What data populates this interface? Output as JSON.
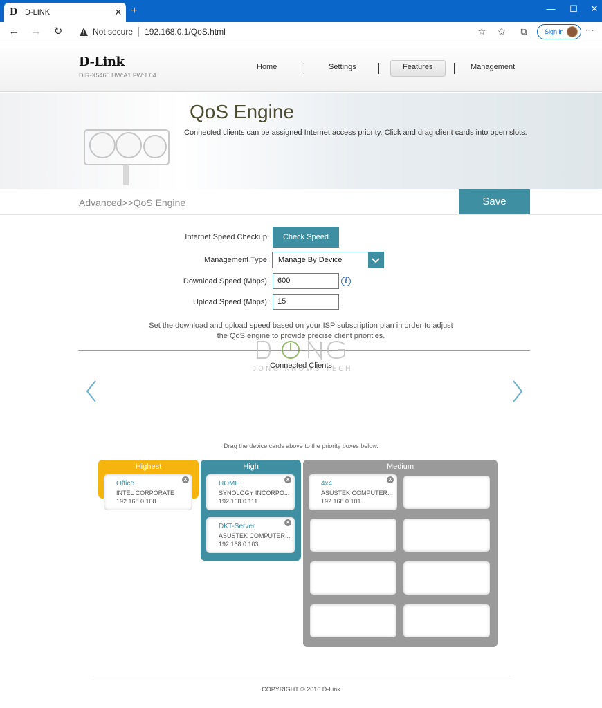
{
  "browser": {
    "tab_title": "D-LINK",
    "tab_favicon": "D",
    "new_tab": "+",
    "not_secure": "Not secure",
    "url": "192.168.0.1/QoS.html",
    "sign_in": "Sign in",
    "icons": [
      "back-arrow-icon",
      "forward-arrow-icon",
      "refresh-icon",
      "warning-triangle-icon",
      "star-add-icon",
      "favorites-icon",
      "collections-icon",
      "more-dots-icon"
    ]
  },
  "header": {
    "logo": "D-Link",
    "model": "DIR-X5460 HW:A1 FW:1.04",
    "menu": [
      "Home",
      "Settings",
      "Features",
      "Management"
    ],
    "active_menu": "Features"
  },
  "banner": {
    "title": "QoS Engine",
    "description": "Connected clients can be assigned Internet access priority. Click and drag client cards into open slots."
  },
  "breadcrumb": "Advanced>>QoS Engine",
  "save_label": "Save",
  "form": {
    "speed_checkup_label": "Internet Speed Checkup:",
    "check_speed_label": "Check Speed",
    "management_type_label": "Management Type:",
    "management_type_value": "Manage By Device",
    "download_label": "Download Speed (Mbps):",
    "download_value": "600",
    "upload_label": "Upload Speed (Mbps):",
    "upload_value": "15",
    "note_line1": "Set the download and upload speed based on your ISP subscription plan in order to adjust",
    "note_line2": "the QoS engine to provide precise client priorities."
  },
  "connected_clients_label": "Connected Clients",
  "drag_hint": "Drag the device cards above to the priority boxes below.",
  "priorities": {
    "highest": {
      "title": "Highest",
      "color": "#f5b50e",
      "cards": [
        {
          "name": "Office",
          "vendor": "INTEL CORPORATE",
          "ip": "192.168.0.108"
        }
      ]
    },
    "high": {
      "title": "High",
      "color": "#3e8fa1",
      "cards": [
        {
          "name": "HOME",
          "vendor": "SYNOLOGY INCORPO...",
          "ip": "192.168.0.111"
        },
        {
          "name": "DKT-Server",
          "vendor": "ASUSTEK COMPUTER...",
          "ip": "192.168.0.103"
        }
      ]
    },
    "medium": {
      "title": "Medium",
      "color": "#9a9a9a",
      "cards": [
        {
          "name": "4x4",
          "vendor": "ASUSTEK COMPUTER...",
          "ip": "192.168.0.101"
        }
      ]
    }
  },
  "watermark": "DONG KNOWS TECH",
  "copyright": "COPYRIGHT © 2016 D-Link"
}
